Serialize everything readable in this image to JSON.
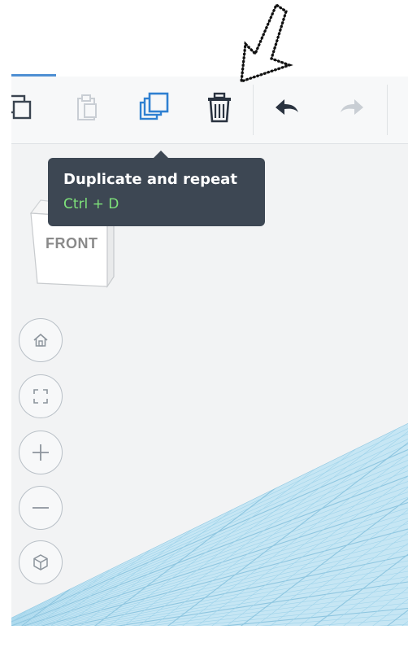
{
  "toolbar": {
    "buttons": [
      {
        "name": "copy",
        "icon": "copy-icon",
        "enabled": true
      },
      {
        "name": "paste",
        "icon": "paste-icon",
        "enabled": false
      },
      {
        "name": "duplicate-and-repeat",
        "icon": "duplicate-icon",
        "enabled": true,
        "active": true
      },
      {
        "name": "delete",
        "icon": "trash-icon",
        "enabled": true
      },
      {
        "name": "undo",
        "icon": "undo-arrow-icon",
        "enabled": true
      },
      {
        "name": "redo",
        "icon": "redo-arrow-icon",
        "enabled": false
      }
    ]
  },
  "tooltip": {
    "title": "Duplicate and repeat",
    "shortcut": "Ctrl + D"
  },
  "view_cube": {
    "face_label": "FRONT"
  },
  "nav_controls": [
    {
      "name": "home-view",
      "icon": "home-icon"
    },
    {
      "name": "fit-all",
      "icon": "fit-view-icon"
    },
    {
      "name": "zoom-in",
      "icon": "plus-icon"
    },
    {
      "name": "zoom-out",
      "icon": "minus-icon"
    },
    {
      "name": "orthographic-view",
      "icon": "cube-icon"
    }
  ],
  "colors": {
    "accent_blue": "#2f80d1",
    "tooltip_bg": "#3d4753",
    "shortcut_green": "#7ee27a",
    "grid_blue": "#9fd3ea",
    "canvas_bg": "#f2f3f4"
  }
}
